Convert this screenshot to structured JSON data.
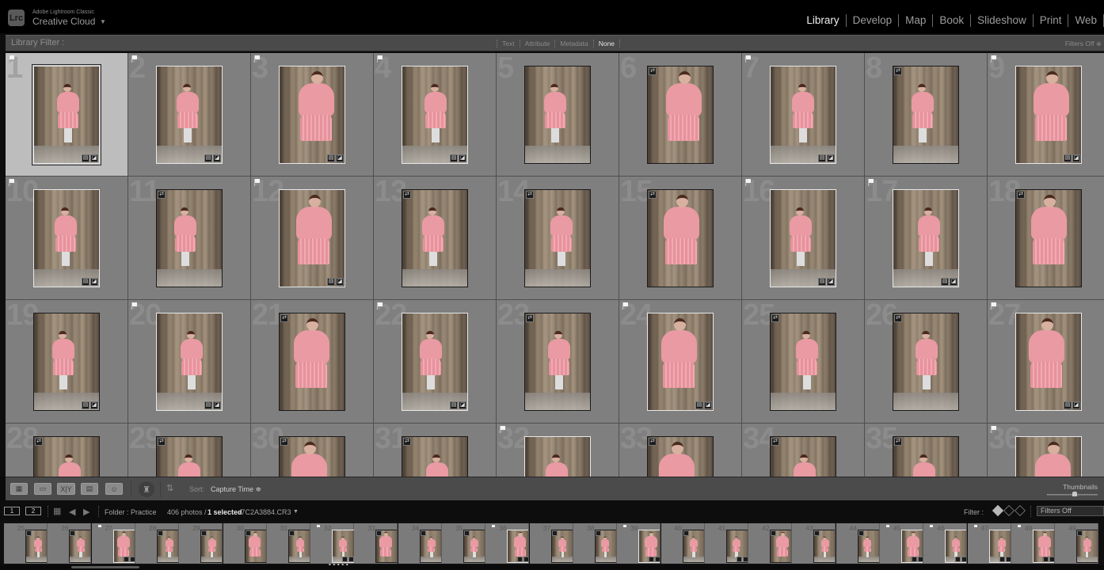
{
  "app": {
    "logo": "Lrc",
    "product": "Adobe Lightroom Classic",
    "title": "Creative Cloud",
    "identity_caret": "▼"
  },
  "modules": [
    {
      "label": "Library",
      "active": true
    },
    {
      "label": "Develop",
      "active": false
    },
    {
      "label": "Map",
      "active": false
    },
    {
      "label": "Book",
      "active": false
    },
    {
      "label": "Slideshow",
      "active": false
    },
    {
      "label": "Print",
      "active": false
    },
    {
      "label": "Web",
      "active": false
    }
  ],
  "library_filter": {
    "label": "Library Filter :",
    "tabs": [
      {
        "label": "Text",
        "active": false
      },
      {
        "label": "Attribute",
        "active": false
      },
      {
        "label": "Metadata",
        "active": false
      },
      {
        "label": "None",
        "active": true
      }
    ],
    "preset": "Filters Off ≑"
  },
  "grid": {
    "columns": 9,
    "cells": [
      {
        "num": "1",
        "picked": true,
        "edited": false,
        "selected": true
      },
      {
        "num": "2",
        "picked": true,
        "edited": false
      },
      {
        "num": "3",
        "picked": true,
        "edited": false
      },
      {
        "num": "4",
        "picked": true,
        "edited": false
      },
      {
        "num": "5",
        "picked": false,
        "edited": false
      },
      {
        "num": "6",
        "picked": false,
        "edited": true
      },
      {
        "num": "7",
        "picked": true,
        "edited": false
      },
      {
        "num": "8",
        "picked": false,
        "edited": true
      },
      {
        "num": "9",
        "picked": true,
        "edited": false
      },
      {
        "num": "10",
        "picked": true,
        "edited": false
      },
      {
        "num": "11",
        "picked": false,
        "edited": true
      },
      {
        "num": "12",
        "picked": true,
        "edited": false
      },
      {
        "num": "13",
        "picked": false,
        "edited": true
      },
      {
        "num": "14",
        "picked": false,
        "edited": true
      },
      {
        "num": "15",
        "picked": false,
        "edited": true
      },
      {
        "num": "16",
        "picked": true,
        "edited": false
      },
      {
        "num": "17",
        "picked": true,
        "edited": false
      },
      {
        "num": "18",
        "picked": false,
        "edited": true
      },
      {
        "num": "19",
        "picked": false,
        "edited": false
      },
      {
        "num": "20",
        "picked": true,
        "edited": false
      },
      {
        "num": "21",
        "picked": false,
        "edited": true
      },
      {
        "num": "22",
        "picked": true,
        "edited": false
      },
      {
        "num": "23",
        "picked": false,
        "edited": true
      },
      {
        "num": "24",
        "picked": true,
        "edited": false
      },
      {
        "num": "25",
        "picked": false,
        "edited": true
      },
      {
        "num": "26",
        "picked": false,
        "edited": true
      },
      {
        "num": "27",
        "picked": true,
        "edited": false
      },
      {
        "num": "28",
        "picked": false,
        "edited": true
      },
      {
        "num": "29",
        "picked": false,
        "edited": true
      },
      {
        "num": "30",
        "picked": false,
        "edited": true
      },
      {
        "num": "31",
        "picked": false,
        "edited": true
      },
      {
        "num": "32",
        "picked": true,
        "edited": false
      },
      {
        "num": "33",
        "picked": false,
        "edited": true
      },
      {
        "num": "34",
        "picked": false,
        "edited": true
      },
      {
        "num": "35",
        "picked": false,
        "edited": true
      },
      {
        "num": "36",
        "picked": true,
        "edited": false
      }
    ]
  },
  "toolbar": {
    "view_buttons": [
      {
        "name": "grid-view",
        "glyph": "▦"
      },
      {
        "name": "loupe-view",
        "glyph": "▭"
      },
      {
        "name": "compare-view",
        "glyph": "X|Y"
      },
      {
        "name": "survey-view",
        "glyph": "▤"
      },
      {
        "name": "people-view",
        "glyph": "☺"
      }
    ],
    "painter_glyph": "♜",
    "sort_glyph": "⇅",
    "sort_label": "Sort:",
    "sort_value": "Capture Time ≑",
    "thumbnails_label": "Thumbnails",
    "thumbnail_size": 0.55
  },
  "filmstrip_header": {
    "screen1": "1",
    "screen2": "2",
    "grid_glyph": "▦",
    "back_glyph": "◀",
    "forward_glyph": "▶",
    "source": "Folder : Practice",
    "count": "406 photos /",
    "selected": "1 selected",
    "filename": "/7C2A3884.CR3",
    "filename_caret": "▼",
    "filter_label": "Filter :",
    "filter_preset": "Filters Off"
  },
  "filmstrip": {
    "items": [
      {
        "num": "25",
        "picked": false,
        "edited": true
      },
      {
        "num": "26",
        "picked": false,
        "edited": true
      },
      {
        "num": "27",
        "picked": true,
        "edited": false
      },
      {
        "num": "28",
        "picked": false,
        "edited": true
      },
      {
        "num": "29",
        "picked": false,
        "edited": true
      },
      {
        "num": "30",
        "picked": false,
        "edited": true
      },
      {
        "num": "31",
        "picked": false,
        "edited": true
      },
      {
        "num": "32",
        "picked": true,
        "edited": false,
        "stars": "★★★★★"
      },
      {
        "num": "33",
        "picked": false,
        "edited": true
      },
      {
        "num": "34",
        "picked": false,
        "edited": true
      },
      {
        "num": "35",
        "picked": false,
        "edited": true
      },
      {
        "num": "36",
        "picked": true,
        "edited": false
      },
      {
        "num": "37",
        "picked": false,
        "edited": true
      },
      {
        "num": "38",
        "picked": false,
        "edited": true
      },
      {
        "num": "39",
        "picked": true,
        "edited": false
      },
      {
        "num": "40",
        "picked": false,
        "edited": true
      },
      {
        "num": "41",
        "picked": false,
        "edited": false
      },
      {
        "num": "42",
        "picked": false,
        "edited": true
      },
      {
        "num": "43",
        "picked": false,
        "edited": true
      },
      {
        "num": "44",
        "picked": false,
        "edited": true
      },
      {
        "num": "45",
        "picked": true,
        "edited": false
      },
      {
        "num": "46",
        "picked": true,
        "edited": false
      },
      {
        "num": "47",
        "picked": true,
        "edited": false
      },
      {
        "num": "48",
        "picked": true,
        "edited": false
      },
      {
        "num": "49",
        "picked": false,
        "edited": true
      }
    ]
  },
  "colors": {
    "panel_bg": "#7f7f7f",
    "selected_cell_bg": "#bdbdbd",
    "chrome_bg": "#000000",
    "active_text": "#eeeeee"
  }
}
